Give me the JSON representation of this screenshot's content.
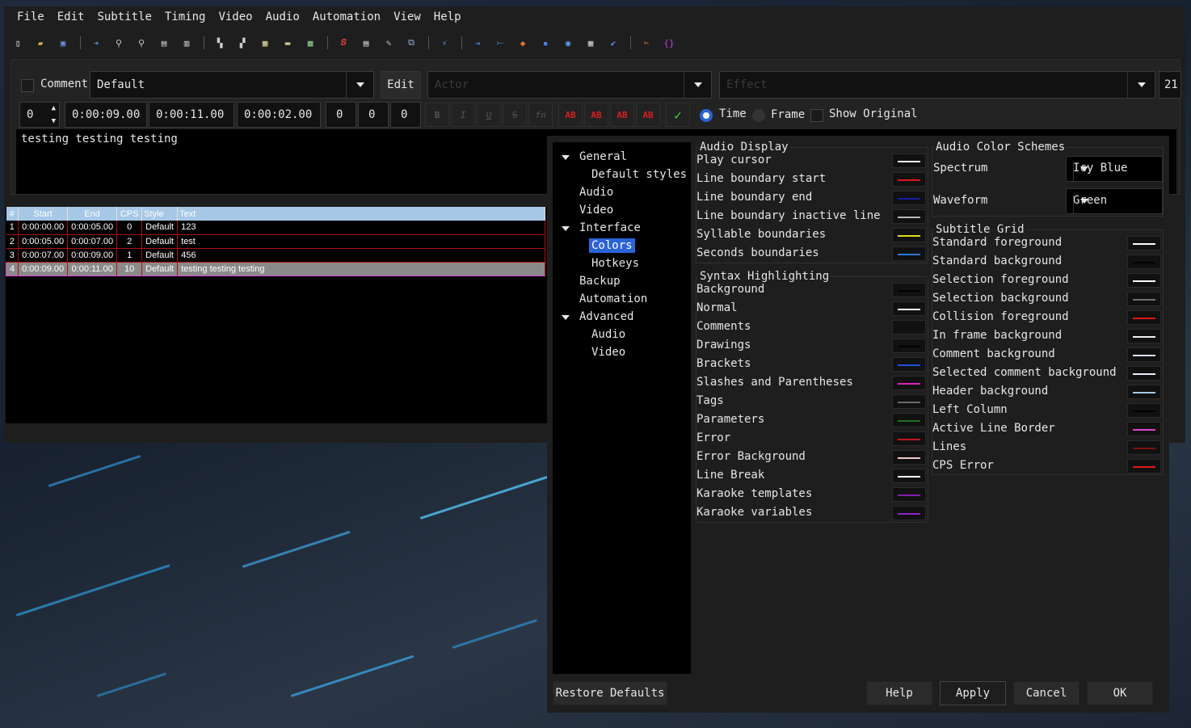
{
  "menu": [
    "File",
    "Edit",
    "Subtitle",
    "Timing",
    "Video",
    "Audio",
    "Automation",
    "View",
    "Help"
  ],
  "editor": {
    "comment_label": "Comment",
    "style_value": "Default",
    "edit_button": "Edit",
    "actor_placeholder": "Actor",
    "effect_placeholder": "Effect",
    "char_count": "21",
    "layer": "0",
    "start_time": "0:00:09.00",
    "end_time": "0:00:11.00",
    "duration": "0:00:02.00",
    "margin_l": "0",
    "margin_r": "0",
    "margin_v": "0",
    "format_buttons": [
      "B",
      "I",
      "U",
      "S",
      "fn",
      "AB",
      "AB",
      "AB",
      "AB"
    ],
    "commit_icon": "checkmark-icon",
    "time_radio": "Time",
    "frame_radio": "Frame",
    "show_original": "Show Original",
    "text": "testing testing testing"
  },
  "grid": {
    "headers": [
      "#",
      "Start",
      "End",
      "CPS",
      "Style",
      "Text"
    ],
    "rows": [
      {
        "n": "1",
        "start": "0:00:00.00",
        "end": "0:00:05.00",
        "cps": "0",
        "style": "Default",
        "text": "123"
      },
      {
        "n": "2",
        "start": "0:00:05.00",
        "end": "0:00:07.00",
        "cps": "2",
        "style": "Default",
        "text": "test"
      },
      {
        "n": "3",
        "start": "0:00:07.00",
        "end": "0:00:09.00",
        "cps": "1",
        "style": "Default",
        "text": "456"
      },
      {
        "n": "4",
        "start": "0:00:09.00",
        "end": "0:00:11.00",
        "cps": "10",
        "style": "Default",
        "text": "testing testing testing"
      }
    ]
  },
  "prefs": {
    "tree": {
      "general": "General",
      "default_styles": "Default styles",
      "audio": "Audio",
      "video": "Video",
      "interface": "Interface",
      "colors": "Colors",
      "hotkeys": "Hotkeys",
      "backup": "Backup",
      "automation": "Automation",
      "advanced": "Advanced",
      "adv_audio": "Audio",
      "adv_video": "Video"
    },
    "audio_display": {
      "title": "Audio Display",
      "items": [
        {
          "label": "Play cursor",
          "color": "#ffffff"
        },
        {
          "label": "Line boundary start",
          "color": "#d81818"
        },
        {
          "label": "Line boundary end",
          "color": "#1a1aa8"
        },
        {
          "label": "Line boundary inactive line",
          "color": "#b8b8b8"
        },
        {
          "label": "Syllable boundaries",
          "color": "#e8d818"
        },
        {
          "label": "Seconds boundaries",
          "color": "#2a7ad8"
        }
      ]
    },
    "syntax": {
      "title": "Syntax Highlighting",
      "items": [
        {
          "label": "Background",
          "color": "#000000"
        },
        {
          "label": "Normal",
          "color": "#ffffff"
        },
        {
          "label": "Comments",
          "color": "#101010"
        },
        {
          "label": "Drawings",
          "color": "#000000"
        },
        {
          "label": "Brackets",
          "color": "#2050e0"
        },
        {
          "label": "Slashes and Parentheses",
          "color": "#e020c0"
        },
        {
          "label": "Tags",
          "color": "#6a6a6a"
        },
        {
          "label": "Parameters",
          "color": "#207020"
        },
        {
          "label": "Error",
          "color": "#c01818"
        },
        {
          "label": "Error Background",
          "color": "#f0c8c8"
        },
        {
          "label": "Line Break",
          "color": "#ffffff"
        },
        {
          "label": "Karaoke templates",
          "color": "#8020b0"
        },
        {
          "label": "Karaoke variables",
          "color": "#9020d0"
        }
      ]
    },
    "schemes": {
      "title": "Audio Color Schemes",
      "spectrum_label": "Spectrum",
      "spectrum_value": "Icy Blue",
      "waveform_label": "Waveform",
      "waveform_value": "Green"
    },
    "grid_colors": {
      "title": "Subtitle Grid",
      "items": [
        {
          "label": "Standard foreground",
          "color": "#ffffff"
        },
        {
          "label": "Standard background",
          "color": "#000000"
        },
        {
          "label": "Selection foreground",
          "color": "#ffffff"
        },
        {
          "label": "Selection background",
          "color": "#707070"
        },
        {
          "label": "Collision foreground",
          "color": "#e01818"
        },
        {
          "label": "In frame background",
          "color": "#f0f0f0"
        },
        {
          "label": "Comment background",
          "color": "#d8e0f0"
        },
        {
          "label": "Selected comment background",
          "color": "#e8eef8"
        },
        {
          "label": "Header background",
          "color": "#a6c8e6"
        },
        {
          "label": "Left Column",
          "color": "#000000"
        },
        {
          "label": "Active Line Border",
          "color": "#e040d0"
        },
        {
          "label": "Lines",
          "color": "#801010"
        },
        {
          "label": "CPS Error",
          "color": "#e01818"
        }
      ]
    },
    "buttons": {
      "restore": "Restore Defaults",
      "help": "Help",
      "apply": "Apply",
      "cancel": "Cancel",
      "ok": "OK"
    }
  }
}
